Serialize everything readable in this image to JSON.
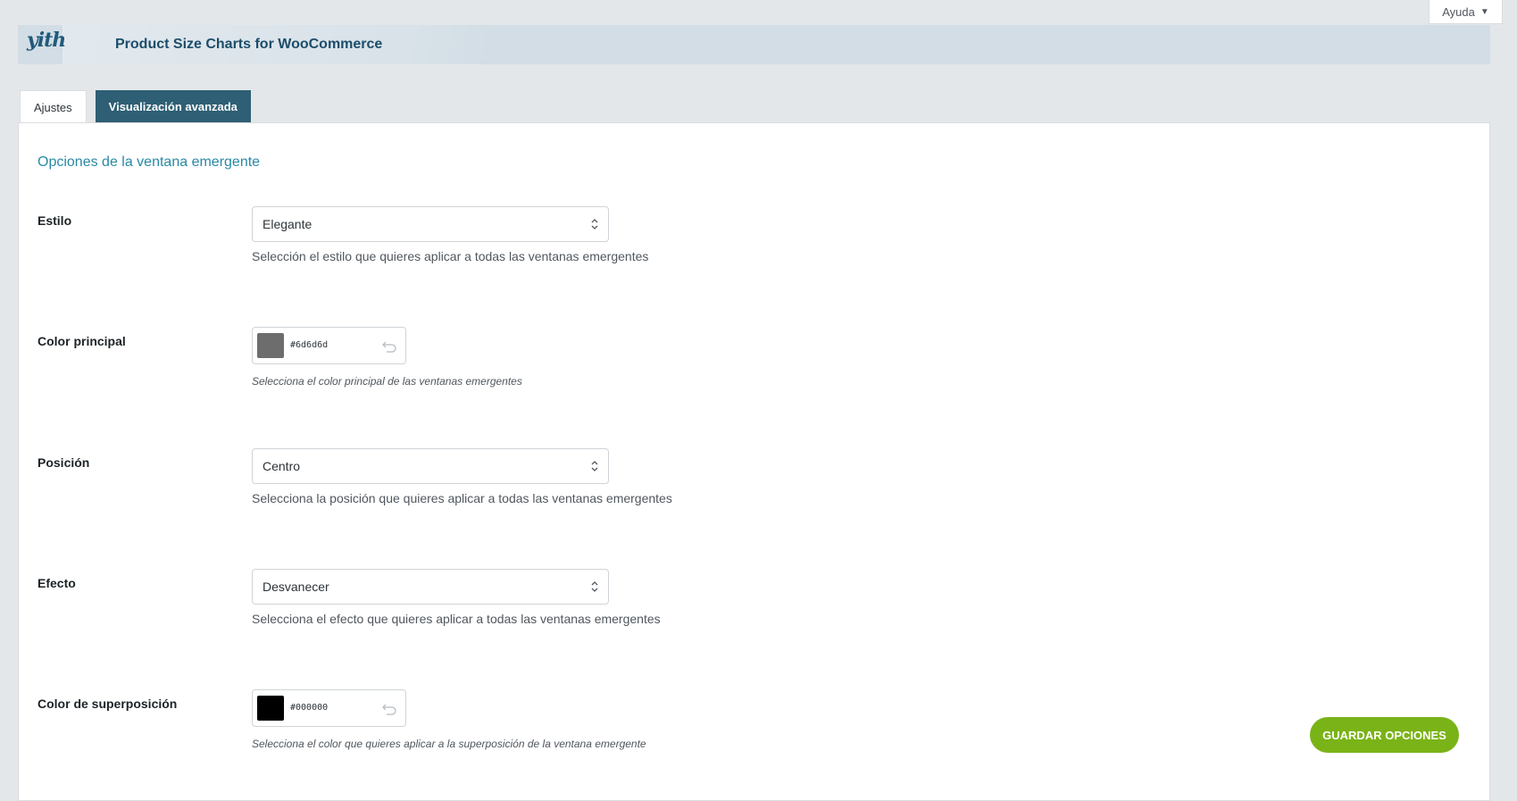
{
  "help_tab": {
    "label": "Ayuda"
  },
  "header": {
    "logo_text": "yith",
    "title": "Product Size Charts for WooCommerce"
  },
  "tabs": [
    {
      "label": "Ajustes",
      "active": true
    },
    {
      "label": "Visualización avanzada",
      "active": false
    }
  ],
  "section": {
    "title": "Opciones de la ventana emergente"
  },
  "fields": {
    "style": {
      "label": "Estilo",
      "value": "Elegante",
      "description": "Selección el estilo que quieres aplicar a todas las ventanas emergentes"
    },
    "main_color": {
      "label": "Color principal",
      "value": "#6d6d6d",
      "swatch": "#6d6d6d",
      "description": "Selecciona el color principal de las ventanas emergentes"
    },
    "position": {
      "label": "Posición",
      "value": "Centro",
      "description": "Selecciona la posición que quieres aplicar a todas las ventanas emergentes"
    },
    "effect": {
      "label": "Efecto",
      "value": "Desvanecer",
      "description": "Selecciona el efecto que quieres aplicar a todas las ventanas emergentes"
    },
    "overlay_color": {
      "label": "Color de superposición",
      "value": "#000000",
      "swatch": "#000000",
      "description": "Selecciona el color que quieres aplicar a la superposición de la ventana emergente"
    }
  },
  "save_button": {
    "label": "GUARDAR OPCIONES"
  },
  "colors": {
    "accent": "#2889a6",
    "tab_inactive": "#2e5f74",
    "save_button": "#7ab317",
    "banner": "#d2dde5"
  }
}
